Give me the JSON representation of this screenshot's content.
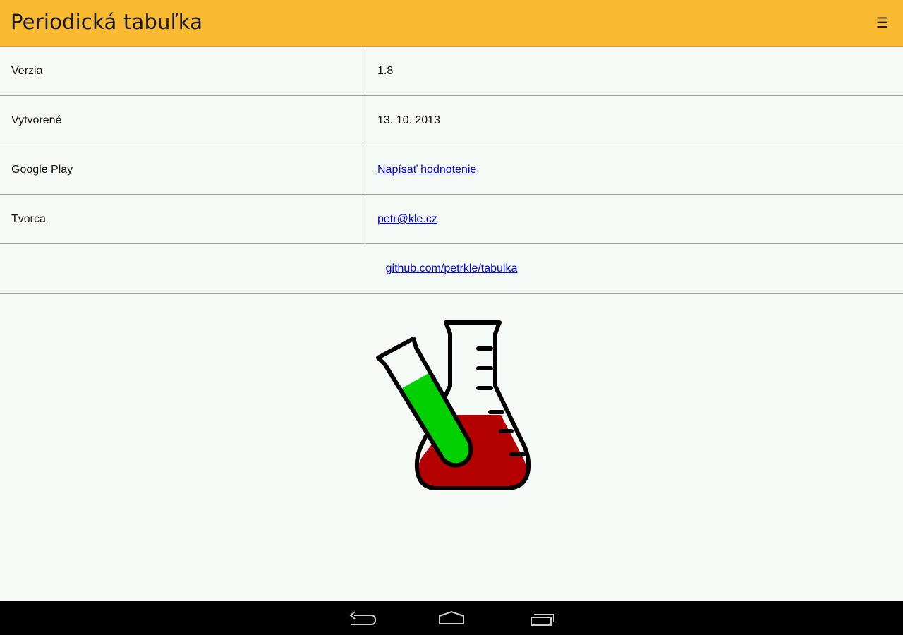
{
  "app_bar": {
    "title": "Periodická tabuľka",
    "menu_icon": "☰"
  },
  "info": {
    "rows": [
      {
        "label": "Verzia",
        "value": "1.8"
      },
      {
        "label": "Vytvorené",
        "value": "13. 10. 2013"
      },
      {
        "label": "Google Play",
        "value": "Napísať hodnotenie"
      },
      {
        "label": "Tvorca",
        "value": "petr@kle.cz"
      }
    ],
    "github_link": "github.com/petrkle/tabulka"
  },
  "logo": {
    "icon": "chemistry-flask-icon",
    "colors": {
      "liquid_flask": "#b30000",
      "liquid_tube": "#00d000",
      "outline": "#000000"
    }
  },
  "nav_bar": {
    "buttons": [
      "back-icon",
      "home-icon",
      "recent-apps-icon"
    ]
  },
  "colors": {
    "app_bar": "#f9ba32",
    "background": "#f6faf6",
    "link": "#0000ee",
    "divider": "#a0a0a0"
  }
}
